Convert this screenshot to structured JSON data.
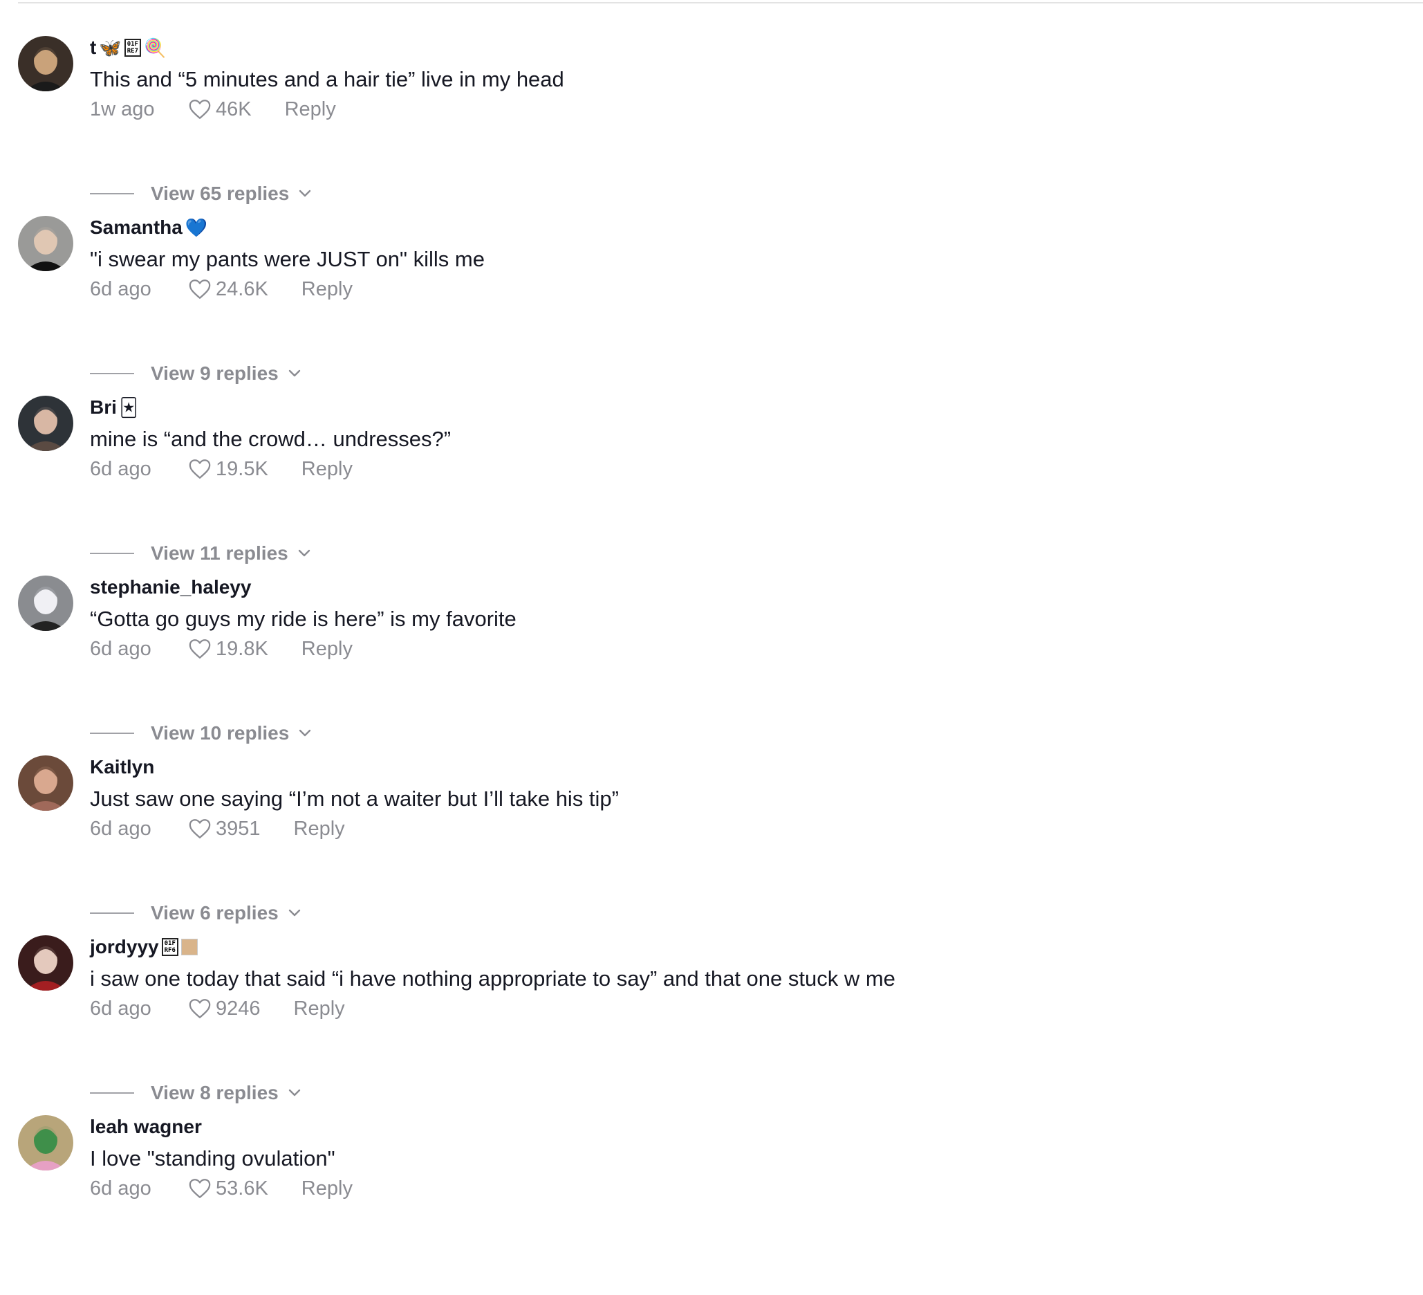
{
  "comments": [
    {
      "username": "t",
      "badges": [
        "butterfly-emoji",
        "unknown-glyph-box",
        "lollipop-emoji"
      ],
      "badge_glyphs": [
        "🦋",
        "01F\nRE7",
        "🍭"
      ],
      "text": "This and “5 minutes and a hair tie” live in my head",
      "time": "1w ago",
      "likes": "46K",
      "reply_label": "Reply",
      "view_replies": "View 65 replies",
      "avatar_colors": [
        "#3a2f28",
        "#c9a27a",
        "#1a1a1a"
      ]
    },
    {
      "username": "Samantha",
      "badges": [
        "blue-heart-emoji"
      ],
      "badge_glyphs": [
        "💙"
      ],
      "text": "\"i swear my pants were JUST on\" kills me",
      "time": "6d ago",
      "likes": "24.6K",
      "reply_label": "Reply",
      "view_replies": "View 9 replies",
      "avatar_colors": [
        "#9a9a98",
        "#e0c7b3",
        "#111111"
      ]
    },
    {
      "username": "Bri",
      "badges": [
        "joker-card-emoji"
      ],
      "badge_glyphs": [
        "🃏"
      ],
      "text": "mine is “and the crowd… undresses?”",
      "time": "6d ago",
      "likes": "19.5K",
      "reply_label": "Reply",
      "view_replies": "View 11 replies",
      "avatar_colors": [
        "#2e3338",
        "#d8b7a4",
        "#5a4a42"
      ]
    },
    {
      "username": "stephanie_haleyy",
      "badges": [],
      "badge_glyphs": [],
      "text": "“Gotta go guys my ride is here” is my favorite",
      "time": "6d ago",
      "likes": "19.8K",
      "reply_label": "Reply",
      "view_replies": "View 10 replies",
      "avatar_colors": [
        "#8a8c90",
        "#f0f0f4",
        "#222222"
      ]
    },
    {
      "username": "Kaitlyn",
      "badges": [],
      "badge_glyphs": [],
      "text": "Just saw one saying “I’m not a waiter but I’ll take his tip”",
      "time": "6d ago",
      "likes": "3951",
      "reply_label": "Reply",
      "view_replies": "View 6 replies",
      "avatar_colors": [
        "#6b4a3a",
        "#d9a88f",
        "#a0695a"
      ]
    },
    {
      "username": "jordyyy",
      "badges": [
        "unknown-glyph-box",
        "skin-tone-swatch"
      ],
      "badge_glyphs": [
        "01F\nRF6",
        ""
      ],
      "text": "i saw one today that said “i have nothing appropriate to say” and that one stuck w me",
      "time": "6d ago",
      "likes": "9246",
      "reply_label": "Reply",
      "view_replies": "View 8 replies",
      "avatar_colors": [
        "#3a1c1c",
        "#e4c9bd",
        "#a31f22"
      ]
    },
    {
      "username": "leah wagner",
      "badges": [],
      "badge_glyphs": [],
      "text": "I love \"standing ovulation\"",
      "time": "6d ago",
      "likes": "53.6K",
      "reply_label": "Reply",
      "view_replies": "",
      "avatar_colors": [
        "#b8a57a",
        "#3f8f4a",
        "#e6a0c4"
      ]
    }
  ],
  "colors": {
    "text_primary": "#161823",
    "text_secondary": "#8a8b91",
    "divider": "#e3e3e3"
  }
}
